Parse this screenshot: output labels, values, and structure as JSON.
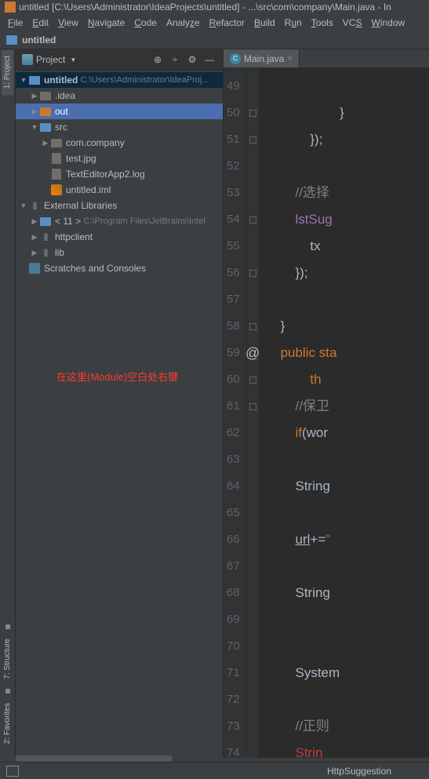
{
  "window": {
    "title": "untitled [C:\\Users\\Administrator\\IdeaProjects\\untitled] - ...\\src\\com\\company\\Main.java - In"
  },
  "menu": {
    "file": "File",
    "edit": "Edit",
    "view": "View",
    "navigate": "Navigate",
    "code": "Code",
    "analyze": "Analyze",
    "refactor": "Refactor",
    "build": "Build",
    "run": "Run",
    "tools": "Tools",
    "vcs": "VCS",
    "window": "Window"
  },
  "nav": {
    "project_name": "untitled"
  },
  "left_tabs": {
    "project": "1: Project",
    "structure": "7: Structure",
    "favorites": "2: Favorites"
  },
  "project_panel": {
    "title": "Project",
    "root": {
      "name": "untitled",
      "path": "C:\\Users\\Administrator\\IdeaProj..."
    },
    "items": {
      "idea": ".idea",
      "out": "out",
      "src": "src",
      "company": "com.company",
      "testjpg": "test.jpg",
      "texteditor": "TextEditorApp2.log",
      "iml": "untitled.iml",
      "ext_lib": "External Libraries",
      "jdk": "< 11 >",
      "jdk_path": "C:\\Program Files\\JetBrains\\Intel",
      "httpclient": "httpclient",
      "lib": "lib",
      "scratches": "Scratches and Consoles"
    }
  },
  "annotation": "在这里(Module)空白处右键",
  "editor": {
    "tab": {
      "name": "Main.java"
    },
    "lines": [
      {
        "n": 49,
        "g": "",
        "html": ""
      },
      {
        "n": 50,
        "g": "box",
        "html": "                    <span class='tok-brace'>}</span>"
      },
      {
        "n": 51,
        "g": "box",
        "html": "            <span class='tok-brace'>});</span>"
      },
      {
        "n": 52,
        "g": "",
        "html": ""
      },
      {
        "n": 53,
        "g": "",
        "html": "        <span class='tok-comment'>//选择</span>"
      },
      {
        "n": 54,
        "g": "box",
        "html": "        <span class='tok-field'>lstSug</span>"
      },
      {
        "n": 55,
        "g": "",
        "html": "            <span class='tok-ident'>tx</span>"
      },
      {
        "n": 56,
        "g": "box",
        "html": "        <span class='tok-brace'>});</span>"
      },
      {
        "n": 57,
        "g": "",
        "html": ""
      },
      {
        "n": 58,
        "g": "box",
        "html": "    <span class='tok-brace'>}</span>"
      },
      {
        "n": 59,
        "g": "at",
        "html": "    <span class='tok-keyword'>public</span> <span class='tok-keyword'>sta</span>"
      },
      {
        "n": 60,
        "g": "box",
        "html": "            <span class='tok-keyword'>th</span>"
      },
      {
        "n": 61,
        "g": "box",
        "html": "        <span class='tok-comment'>//保卫</span>"
      },
      {
        "n": 62,
        "g": "",
        "html": "        <span class='tok-keyword'>if</span><span class='tok-brace'>(</span><span class='tok-ident'>wor</span>"
      },
      {
        "n": 63,
        "g": "",
        "html": ""
      },
      {
        "n": 64,
        "g": "",
        "html": "        <span class='tok-ident'>String</span>"
      },
      {
        "n": 65,
        "g": "",
        "html": ""
      },
      {
        "n": 66,
        "g": "",
        "html": "        <span class='tok-ident tok-link'>url</span><span class='tok-brace'>+=</span><span class='tok-str'>\"</span>"
      },
      {
        "n": 67,
        "g": "",
        "html": ""
      },
      {
        "n": 68,
        "g": "",
        "html": "        <span class='tok-ident'>String</span>"
      },
      {
        "n": 69,
        "g": "",
        "html": ""
      },
      {
        "n": 70,
        "g": "",
        "html": ""
      },
      {
        "n": 71,
        "g": "",
        "html": "        <span class='tok-ident'>System</span>"
      },
      {
        "n": 72,
        "g": "",
        "html": ""
      },
      {
        "n": 73,
        "g": "",
        "html": "        <span class='tok-comment'>//正则</span>"
      },
      {
        "n": 74,
        "g": "",
        "html": "        <span class='tok-err'>Strin</span>"
      }
    ]
  },
  "status": {
    "breadcrumb": "HttpSuggestion"
  }
}
